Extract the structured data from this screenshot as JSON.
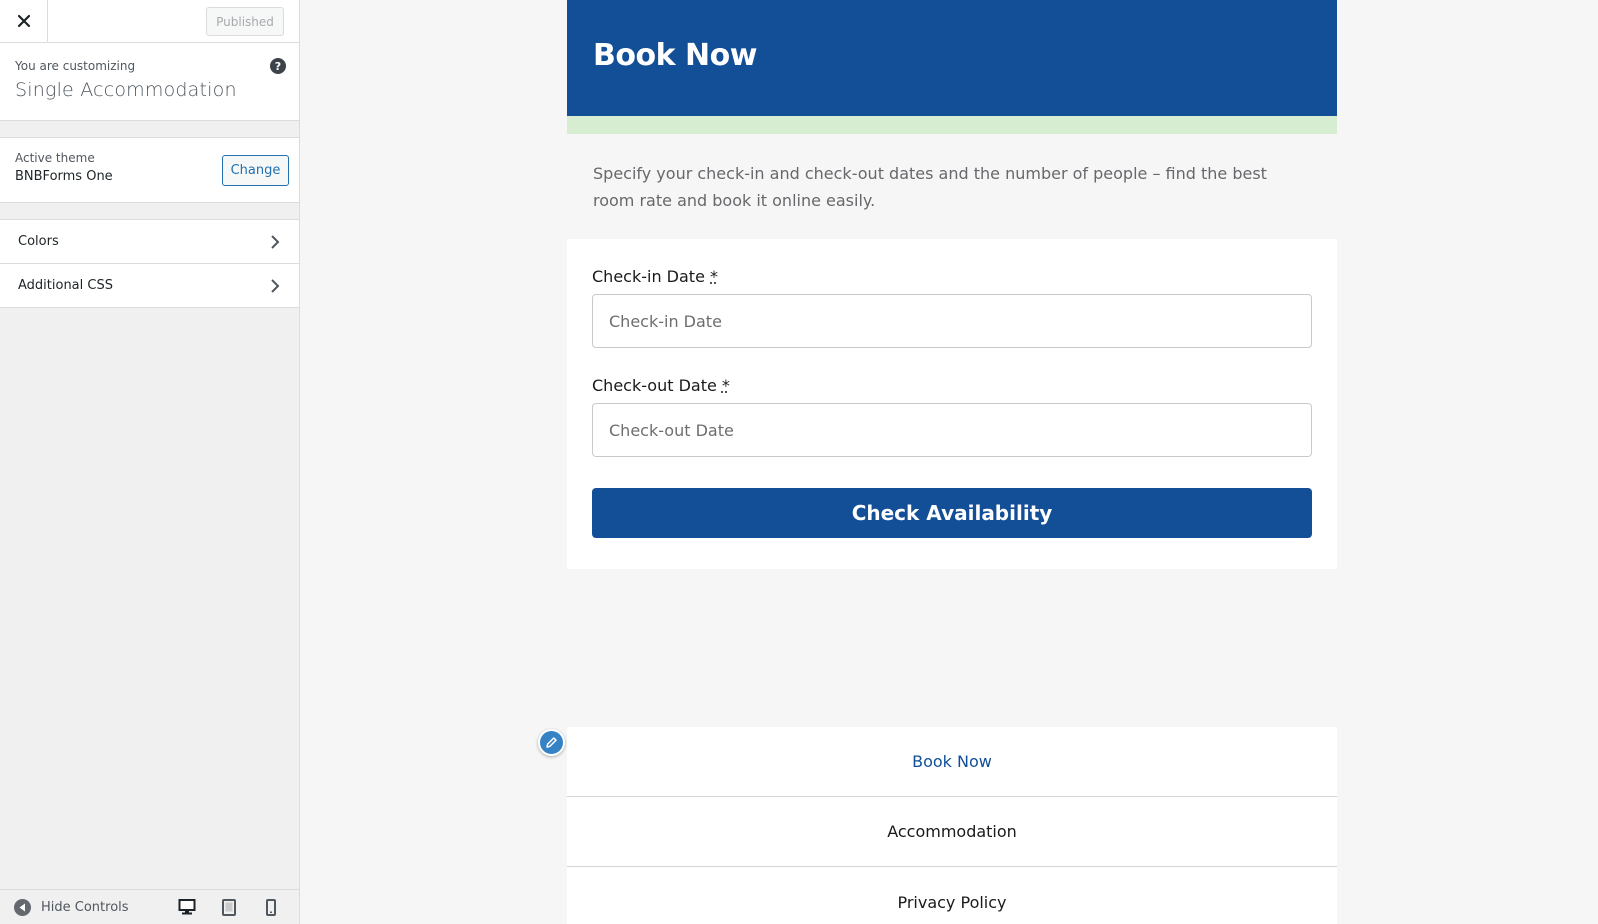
{
  "sidebar": {
    "publish_label": "Published",
    "customizing_label": "You are customizing",
    "customizing_title": "Single Accommodation",
    "help_glyph": "?",
    "theme": {
      "label": "Active theme",
      "name": "BNBForms One",
      "change_label": "Change"
    },
    "sections": [
      {
        "label": "Colors"
      },
      {
        "label": "Additional CSS"
      }
    ],
    "footer": {
      "hide_controls_label": "Hide Controls"
    }
  },
  "preview": {
    "header_title": "Book Now",
    "intro_text": "Specify your check-in and check-out dates and the number of people – find the best room rate and book it online easily.",
    "form": {
      "checkin_label": "Check-in Date",
      "checkin_placeholder": "Check-in Date",
      "checkout_label": "Check-out Date",
      "checkout_placeholder": "Check-out Date",
      "required_mark": "*",
      "submit_label": "Check Availability"
    },
    "footer_nav": [
      {
        "label": "Book Now"
      },
      {
        "label": "Accommodation"
      },
      {
        "label": "Privacy Policy"
      }
    ]
  },
  "colors": {
    "brand_blue": "#124f97",
    "accent_green": "#d7edd2",
    "wp_blue": "#2271b1"
  },
  "icons": [
    "close-icon",
    "help-icon",
    "chevron-right-icon",
    "hide-controls-icon",
    "desktop-icon",
    "tablet-icon",
    "mobile-icon",
    "pencil-icon"
  ]
}
